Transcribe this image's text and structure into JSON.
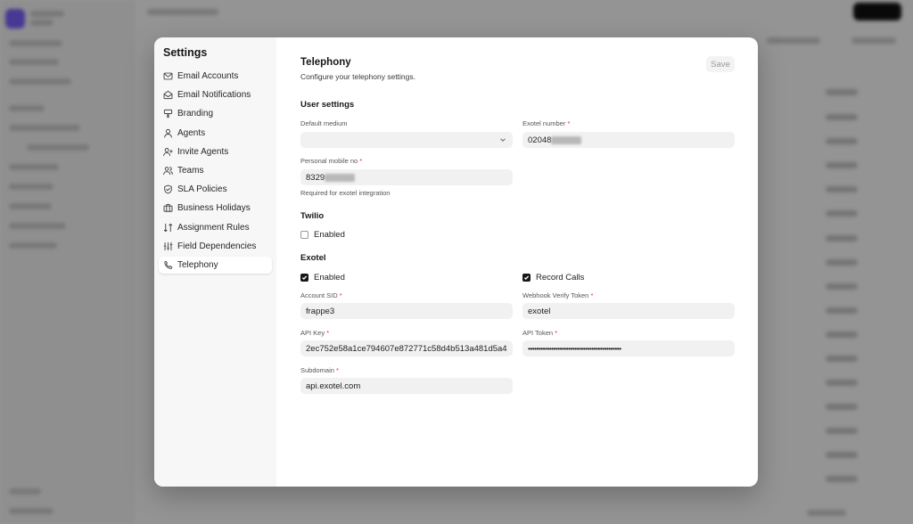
{
  "settings": {
    "title": "Settings",
    "nav": [
      {
        "label": "Email Accounts",
        "icon": "mail-icon"
      },
      {
        "label": "Email Notifications",
        "icon": "mail-open-icon"
      },
      {
        "label": "Branding",
        "icon": "paint-icon"
      },
      {
        "label": "Agents",
        "icon": "user-icon"
      },
      {
        "label": "Invite Agents",
        "icon": "user-plus-icon"
      },
      {
        "label": "Teams",
        "icon": "users-icon"
      },
      {
        "label": "SLA Policies",
        "icon": "shield-icon"
      },
      {
        "label": "Business Holidays",
        "icon": "briefcase-icon"
      },
      {
        "label": "Assignment Rules",
        "icon": "git-branch-icon"
      },
      {
        "label": "Field Dependencies",
        "icon": "sliders-icon"
      },
      {
        "label": "Telephony",
        "icon": "phone-icon",
        "active": true
      }
    ]
  },
  "telephony": {
    "title": "Telephony",
    "subtitle": "Configure your telephony settings.",
    "save_label": "Save",
    "user_settings": {
      "heading": "User settings",
      "default_medium_label": "Default medium",
      "default_medium_value": "",
      "exotel_number_label": "Exotel number",
      "exotel_number_value": "02048",
      "personal_mobile_label": "Personal mobile no",
      "personal_mobile_value": "8329",
      "personal_mobile_hint": "Required for exotel integration"
    },
    "twilio": {
      "heading": "Twilio",
      "enabled_label": "Enabled",
      "enabled": false
    },
    "exotel": {
      "heading": "Exotel",
      "enabled_label": "Enabled",
      "enabled": true,
      "record_calls_label": "Record Calls",
      "record_calls": true,
      "account_sid_label": "Account SID",
      "account_sid_value": "frappe3",
      "webhook_token_label": "Webhook Verify Token",
      "webhook_token_value": "exotel",
      "api_key_label": "API Key",
      "api_key_value": "2ec752e58a1ce794607e872771c58d4b513a481d5a4",
      "api_token_label": "API Token",
      "api_token_value": "••••••••••••••••••••••••••••••••••••••••••••",
      "subdomain_label": "Subdomain",
      "subdomain_value": "api.exotel.com"
    },
    "required_mark": "*"
  }
}
